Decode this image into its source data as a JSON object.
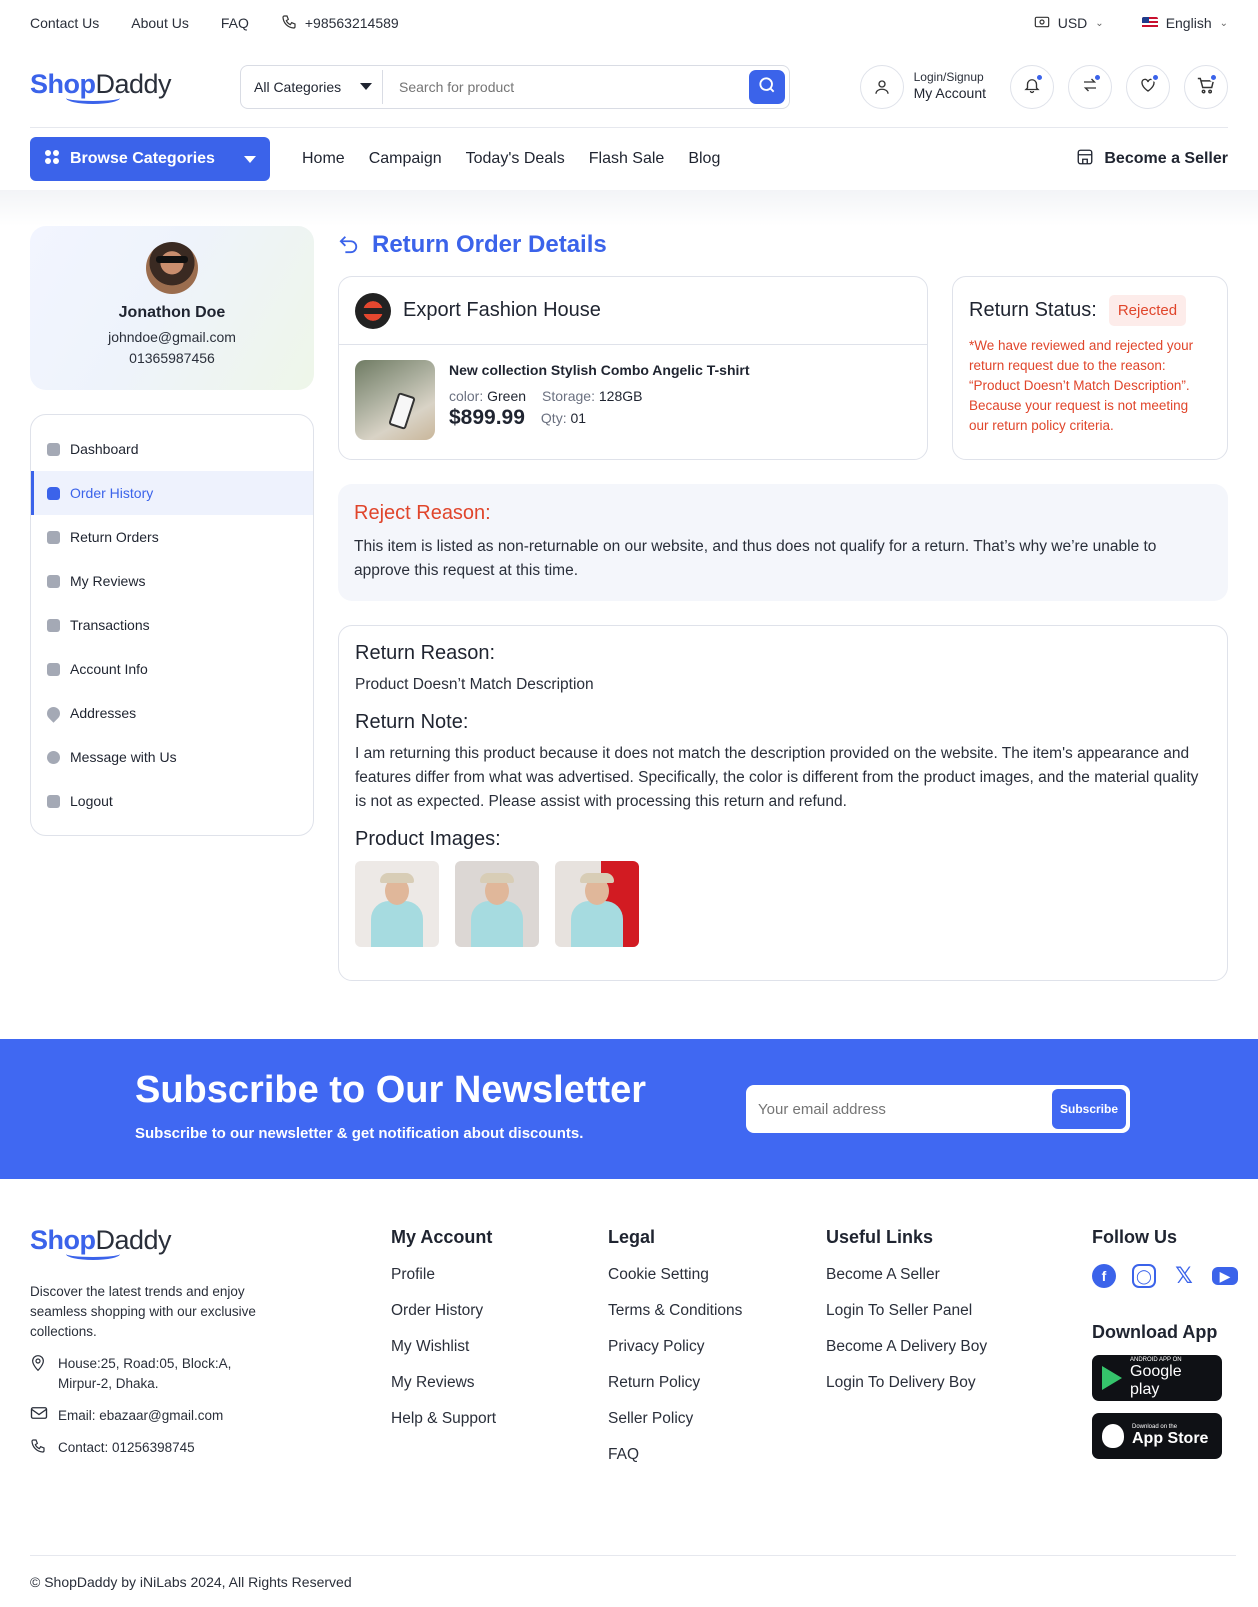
{
  "topbar": {
    "links": [
      "Contact Us",
      "About Us",
      "FAQ"
    ],
    "phone": "+98563214589",
    "currency": "USD",
    "language": "English"
  },
  "brand": {
    "part1": "Shop",
    "part2": "Daddy"
  },
  "search": {
    "category": "All Categories",
    "placeholder": "Search for product"
  },
  "account": {
    "small": "Login/Signup",
    "big": "My Account"
  },
  "nav": {
    "browse": "Browse Categories",
    "links": [
      "Home",
      "Campaign",
      "Today's Deals",
      "Flash Sale",
      "Blog"
    ],
    "seller": "Become a Seller"
  },
  "profile": {
    "name": "Jonathon Doe",
    "email": "johndoe@gmail.com",
    "phone": "01365987456"
  },
  "menu": [
    {
      "label": "Dashboard",
      "icon": "dashboard-icon"
    },
    {
      "label": "Order History",
      "icon": "bag-icon",
      "active": true
    },
    {
      "label": "Return Orders",
      "icon": "return-icon"
    },
    {
      "label": "My Reviews",
      "icon": "star-icon"
    },
    {
      "label": "Transactions",
      "icon": "card-icon"
    },
    {
      "label": "Account Info",
      "icon": "id-card-icon"
    },
    {
      "label": "Addresses",
      "icon": "location-icon"
    },
    {
      "label": "Message with Us",
      "icon": "chat-icon"
    },
    {
      "label": "Logout",
      "icon": "logout-icon"
    }
  ],
  "page": {
    "title": "Return Order Details"
  },
  "shop": {
    "name": "Export Fashion House"
  },
  "product": {
    "title": "New collection Stylish Combo Angelic T-shirt",
    "color_label": "color:",
    "color": "Green",
    "storage_label": "Storage:",
    "storage": "128GB",
    "price": "$899.99",
    "qty_label": "Qty:",
    "qty": "01"
  },
  "status": {
    "label": "Return Status:",
    "badge": "Rejected",
    "message": "*We have reviewed and rejected your return request due to the reason: “Product Doesn’t Match Description”. Because your request is not meeting our return policy criteria."
  },
  "reject": {
    "title": "Reject Reason:",
    "text": "This item is listed as non-returnable on our website, and thus does not qualify for a return. That’s why we’re unable to approve this request at this time."
  },
  "return_reason": {
    "title": "Return Reason:",
    "text": "Product Doesn’t Match Description"
  },
  "return_note": {
    "title": "Return Note:",
    "text": "I am returning this product because it does not match the description provided on the website. The item's appearance and features differ from what was advertised. Specifically, the color is different from the product images, and the material quality is not as expected. Please assist with processing this return and refund."
  },
  "product_images": {
    "title": "Product Images:"
  },
  "newsletter": {
    "title": "Subscribe to Our Newsletter",
    "subtitle": "Subscribe to our newsletter & get notification about discounts.",
    "placeholder": "Your email address",
    "button": "Subscribe"
  },
  "footer": {
    "about": "Discover the latest trends and enjoy seamless shopping with our exclusive collections.",
    "address": "House:25, Road:05, Block:A, Mirpur-2, Dhaka.",
    "email": "Email: ebazaar@gmail.com",
    "contact": "Contact: 01256398745",
    "my_account": {
      "title": "My Account",
      "links": [
        "Profile",
        "Order History",
        "My Wishlist",
        "My Reviews",
        "Help & Support"
      ]
    },
    "legal": {
      "title": "Legal",
      "links": [
        "Cookie Setting",
        "Terms & Conditions",
        "Privacy Policy",
        "Return Policy",
        "Seller Policy",
        "FAQ"
      ]
    },
    "useful": {
      "title": "Useful Links",
      "links": [
        "Become A Seller",
        "Login To Seller Panel",
        "Become A Delivery Boy",
        "Login To Delivery Boy"
      ]
    },
    "follow": "Follow Us",
    "download": "Download App",
    "google_small": "ANDROID APP ON",
    "google_big": "Google play",
    "apple_small": "Download on the",
    "apple_big": "App Store",
    "copyright": "© ShopDaddy by iNiLabs 2024, All Rights Reserved"
  },
  "colors": {
    "accent": "#3b63ea",
    "danger": "#e0452b",
    "newsletter": "#4068f2"
  }
}
